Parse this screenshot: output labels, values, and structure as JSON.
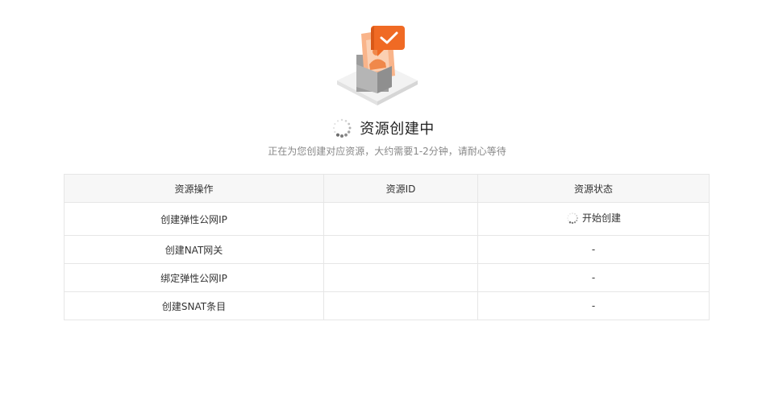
{
  "header": {
    "title": "资源创建中",
    "subtitle": "正在为您创建对应资源，大约需要1-2分钟，请耐心等待",
    "illustration_icon": "document-check-box-icon",
    "spinner_icon": "loading-spinner-icon"
  },
  "table": {
    "columns": [
      "资源操作",
      "资源ID",
      "资源状态"
    ],
    "rows": [
      {
        "operation": "创建弹性公网IP",
        "resource_id": "",
        "status": "开始创建",
        "status_icon": "loading-spinner-icon"
      },
      {
        "operation": "创建NAT网关",
        "resource_id": "",
        "status": "-"
      },
      {
        "operation": "绑定弹性公网IP",
        "resource_id": "",
        "status": "-"
      },
      {
        "operation": "创建SNAT条目",
        "resource_id": "",
        "status": "-"
      }
    ]
  },
  "colors": {
    "accent": "#f06a24",
    "accent_light": "#f9a875",
    "grey_box": "#9a9a9a",
    "header_bg": "#f7f7f7",
    "border": "#e6e6e6"
  }
}
